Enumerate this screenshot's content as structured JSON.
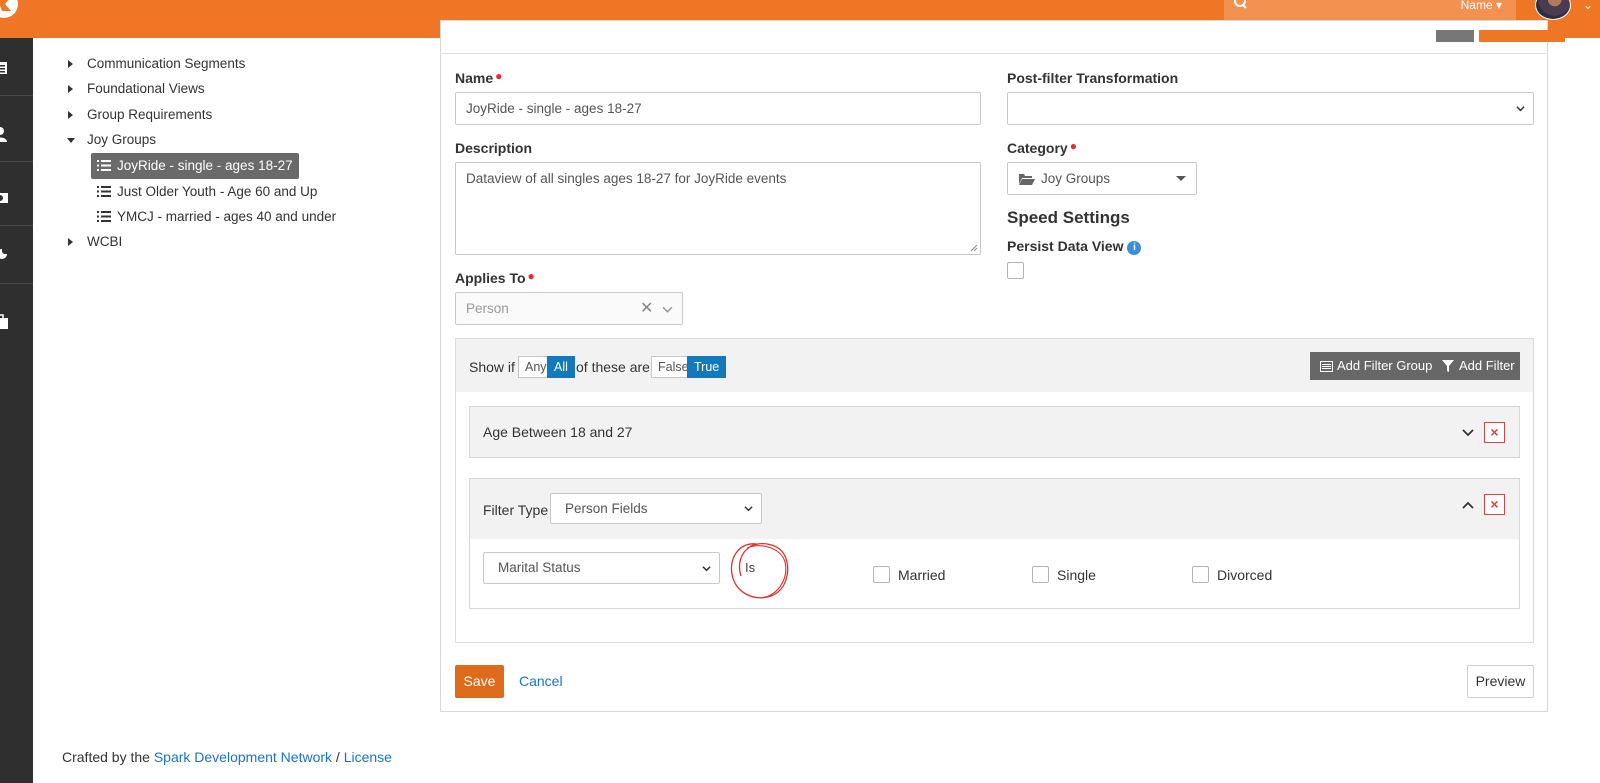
{
  "header": {
    "search_filter_label": "Name",
    "accent_color": "#ee7624"
  },
  "tree": {
    "items": [
      {
        "label": "Communication Segments",
        "expanded": false
      },
      {
        "label": "Foundational Views",
        "expanded": false
      },
      {
        "label": "Group Requirements",
        "expanded": false
      },
      {
        "label": "Joy Groups",
        "expanded": true
      },
      {
        "label": "WCBI",
        "expanded": false
      }
    ],
    "children": [
      {
        "label": "JoyRide - single - ages 18-27",
        "selected": true
      },
      {
        "label": "Just Older Youth - Age 60 and Up",
        "selected": false
      },
      {
        "label": "YMCJ - married - ages 40 and under",
        "selected": false
      }
    ]
  },
  "form": {
    "name_label": "Name",
    "name_value": "JoyRide - single - ages 18-27",
    "description_label": "Description",
    "description_value": "Dataview of all singles ages 18-27 for JoyRide events",
    "applies_to_label": "Applies To",
    "applies_to_value": "Person",
    "post_filter_label": "Post-filter Transformation",
    "post_filter_value": "",
    "category_label": "Category",
    "category_value": "Joy Groups",
    "speed_settings_heading": "Speed Settings",
    "persist_label": "Persist Data View"
  },
  "filters": {
    "show_if": "Show if",
    "any": "Any",
    "all": "All",
    "of_these_are": "of these are",
    "false_label": "False",
    "true_label": "True",
    "add_filter_group": "Add Filter Group",
    "add_filter": "Add Filter",
    "filter1_title": "Age Between 18 and 27",
    "filter_type_label": "Filter Type",
    "filter_type_value": "Person Fields",
    "field_value": "Marital Status",
    "comparison": "Is",
    "options": [
      "Married",
      "Single",
      "Divorced"
    ]
  },
  "actions": {
    "save": "Save",
    "cancel": "Cancel",
    "preview": "Preview"
  },
  "footer": {
    "prefix": "Crafted by the",
    "link1": "Spark Development Network",
    "sep": "/",
    "link2": "License"
  }
}
